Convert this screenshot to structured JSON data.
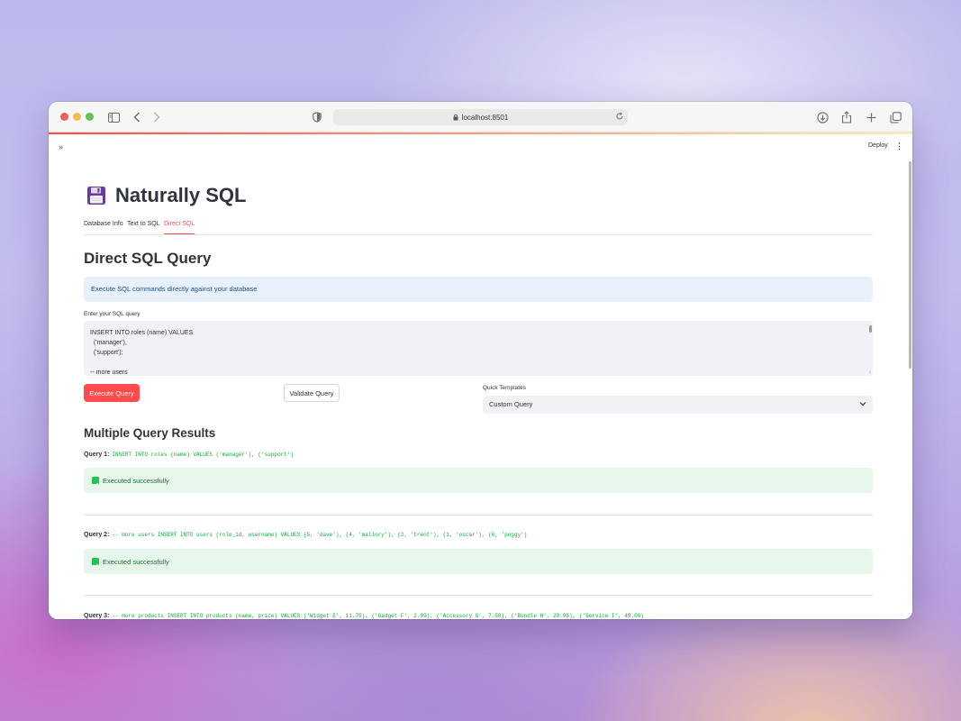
{
  "browser": {
    "url": "localhost:8501"
  },
  "header": {
    "deploy_label": "Deploy",
    "menu_icon": "more-vertical-icon",
    "sidebar_toggle": "»"
  },
  "app": {
    "title": "Naturally SQL",
    "logo_icon": "floppy-disk-icon"
  },
  "tabs": [
    {
      "label": "Database Info",
      "active": false
    },
    {
      "label": "Text to SQL",
      "active": false
    },
    {
      "label": "Direct SQL",
      "active": true
    }
  ],
  "main": {
    "heading": "Direct SQL Query",
    "info": "Execute SQL commands directly against your database",
    "query_label": "Enter your SQL query",
    "query_value": "INSERT INTO roles (name) VALUES\n  ('manager'),\n  ('support');\n\n-- more users",
    "execute_label": "Execute Query",
    "validate_label": "Validate Query",
    "templates_label": "Quick Templates",
    "templates_value": "Custom Query"
  },
  "results": {
    "heading": "Multiple Query Results",
    "queries": [
      {
        "label": "Query 1:",
        "sql": "INSERT INTO roles (name) VALUES   ('manager'),   ('support')",
        "status": "Executed successfully"
      },
      {
        "label": "Query 2:",
        "sql": "-- more users INSERT INTO users (role_id, username) VALUES   (5, 'dave'),   (4, 'mallory'),   (2, 'trent'),   (1, 'oscar'),   (6, 'peggy')",
        "status": "Executed successfully"
      },
      {
        "label": "Query 3:",
        "sql": "-- more products INSERT INTO products (name, price) VALUES   ('Widget E', 11.75),   ('Gadget F', 2.99),   ('Accessory G', 7.50),   ('Bundle H', 29.95),   ('Service I', 49.00)"
      }
    ]
  },
  "colors": {
    "accent": "#ff4b4b",
    "success_bg": "#e6f6ea",
    "info_bg": "#e8f1fb",
    "code_green": "#09ab3b"
  }
}
